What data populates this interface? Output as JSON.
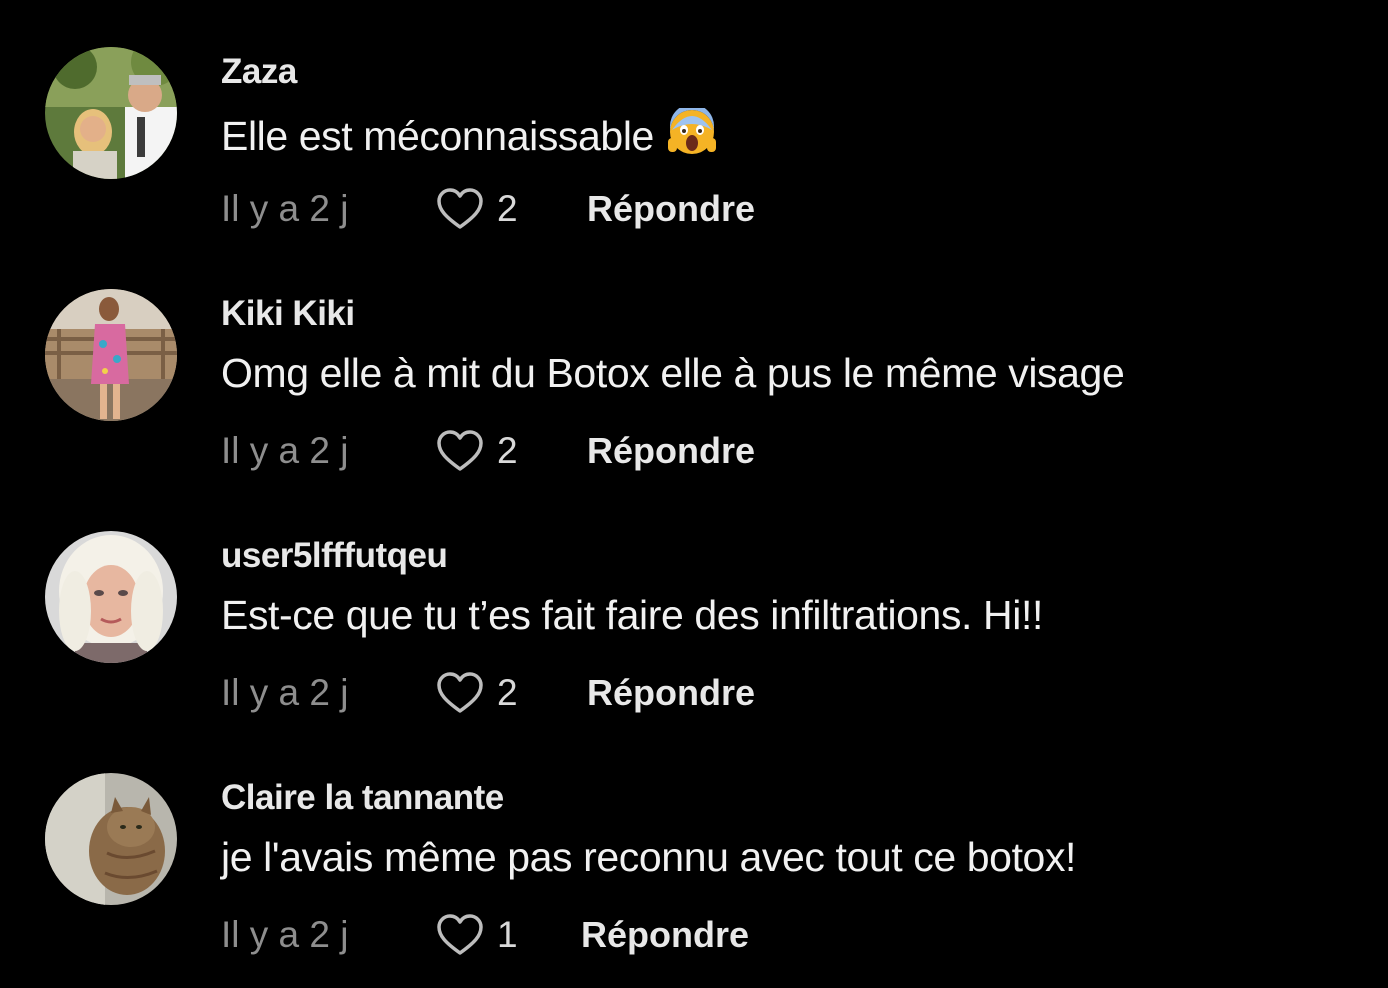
{
  "comments": [
    {
      "username": "Zaza",
      "text": "Elle est méconnaissable",
      "emoji": "😱",
      "time": "Il y a 2 j",
      "likes": "2",
      "reply_label": "Répondre"
    },
    {
      "username": "Kiki Kiki",
      "text": "Omg elle à mit du Botox elle à pus le même visage",
      "time": "Il y a 2 j",
      "likes": "2",
      "reply_label": "Répondre"
    },
    {
      "username": "user5lfffutqeu",
      "text": "Est-ce que tu t’es fait faire des infiltrations. Hi!!",
      "time": "Il y a 2 j",
      "likes": "2",
      "reply_label": "Répondre"
    },
    {
      "username": "Claire la tannante",
      "text": "je l'avais même pas reconnu avec tout ce botox!",
      "time": "Il y a 2 j",
      "likes": "1",
      "reply_label": "Répondre"
    }
  ],
  "icons": {
    "like": "heart-outline-icon",
    "emoji": "screaming-face-emoji"
  },
  "colors": {
    "background": "#000000",
    "username": "#e8e8e8",
    "text": "#f1f1f1",
    "timestamp": "#8e8e8e"
  }
}
